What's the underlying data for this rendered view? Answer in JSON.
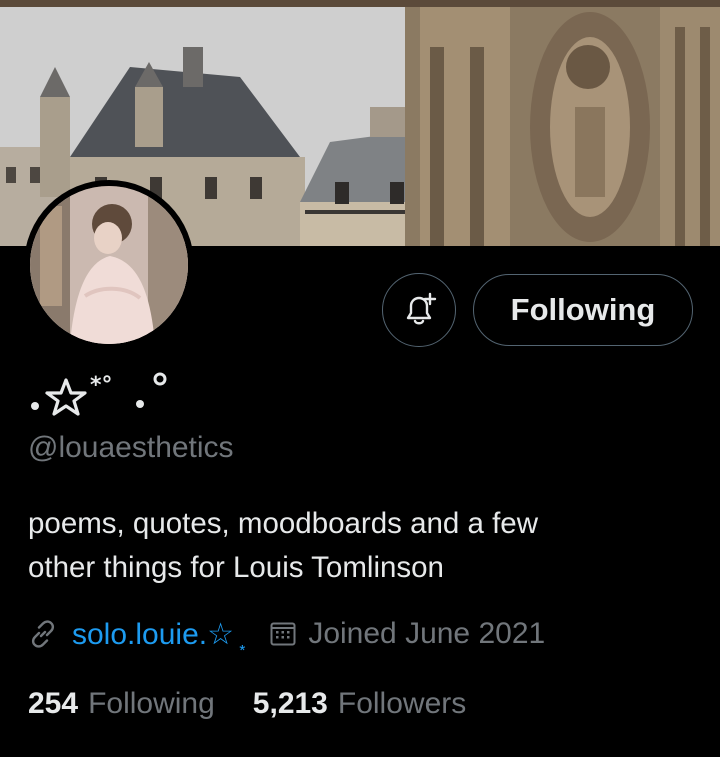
{
  "header": {
    "follow_button_label": "Following"
  },
  "profile": {
    "display_name": ". ☆*° .°",
    "handle": "@louaesthetics",
    "bio": "poems, quotes, moodboards and a few\nother things  for Louis Tomlinson",
    "website": "solo.louie.☆ ͙",
    "joined": "Joined June 2021"
  },
  "stats": {
    "following_count": "254",
    "following_label": "Following",
    "followers_count": "5,213",
    "followers_label": "Followers"
  },
  "icons": {
    "notify": "bell-plus-icon",
    "link": "link-icon",
    "calendar": "calendar-icon"
  },
  "colors": {
    "background": "#000000",
    "text_primary": "#e7e9ea",
    "text_secondary": "#71767b",
    "accent": "#1d9bf0",
    "border": "#536471"
  }
}
